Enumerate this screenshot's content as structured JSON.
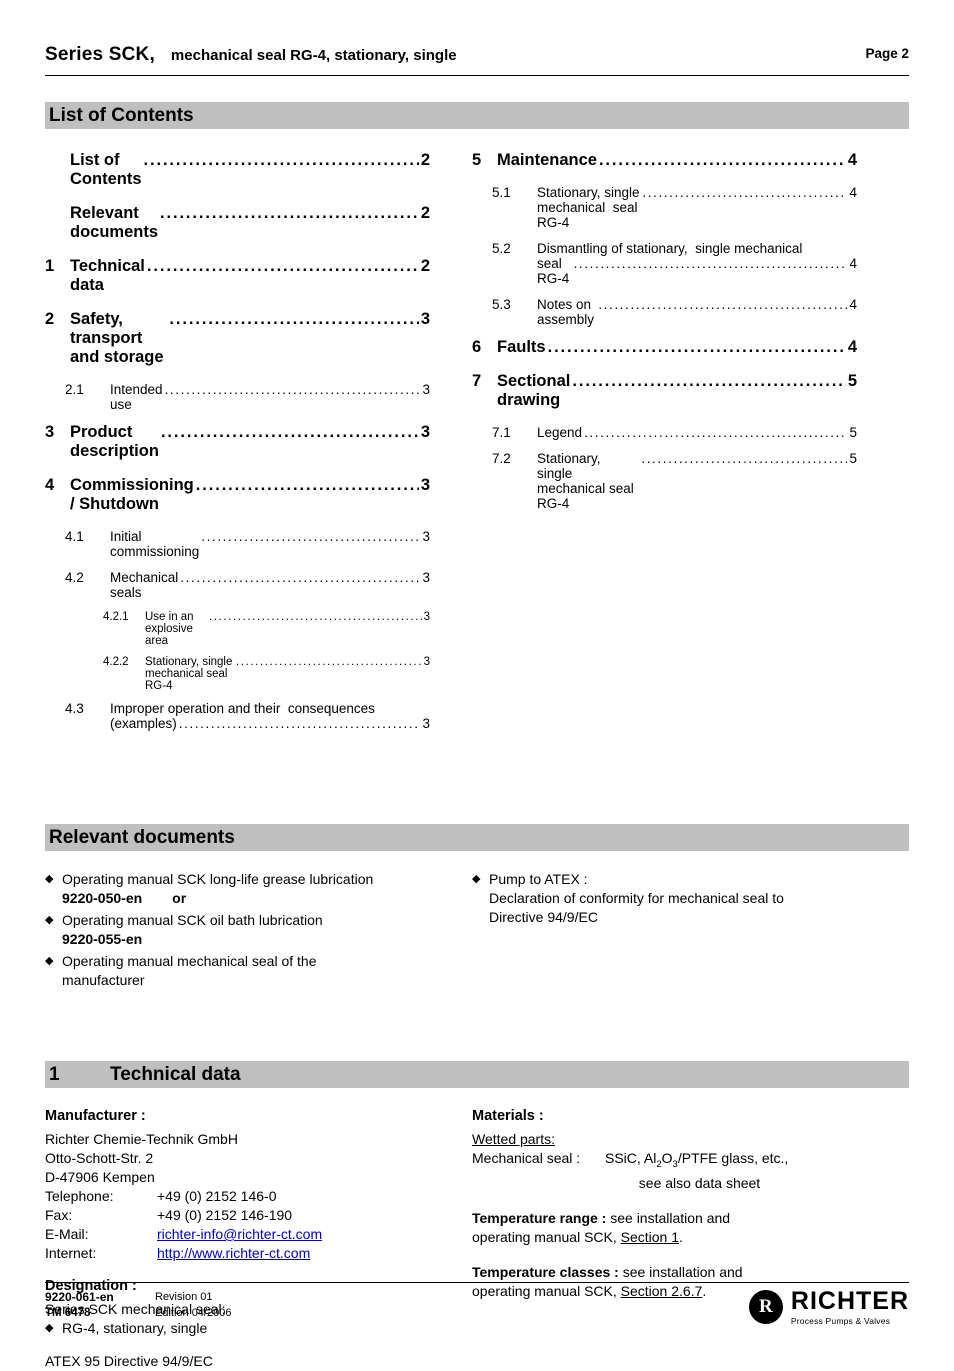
{
  "header": {
    "series": "Series SCK,",
    "subtitle": "mechanical seal RG-4, stationary, single",
    "page": "Page 2"
  },
  "toc": {
    "bar_title": "List of Contents",
    "left": [
      {
        "level": 1,
        "num": "",
        "text": "List of Contents",
        "page": "2"
      },
      {
        "level": 1,
        "num": "",
        "text": "Relevant documents",
        "page": "2"
      },
      {
        "level": 1,
        "num": "1",
        "text": "Technical data",
        "page": "2"
      },
      {
        "level": 1,
        "num": "2",
        "text": "Safety, transport and storage",
        "page": "3"
      },
      {
        "level": 2,
        "num": "2.1",
        "text": "Intended use",
        "page": "3"
      },
      {
        "level": 1,
        "num": "3",
        "text": "Product description",
        "page": "3"
      },
      {
        "level": 1,
        "num": "4",
        "text": "Commissioning / Shutdown",
        "page": "3"
      },
      {
        "level": 2,
        "num": "4.1",
        "text": "Initial commissioning",
        "page": "3"
      },
      {
        "level": 2,
        "num": "4.2",
        "text": "Mechanical seals",
        "page": "3"
      },
      {
        "level": 3,
        "num": "4.2.1",
        "text": "Use in an explosive area",
        "page": "3"
      },
      {
        "level": 3,
        "num": "4.2.2",
        "text": "Stationary, single mechanical seal  RG-4",
        "page": "3"
      },
      {
        "level": 2,
        "num": "4.3",
        "text": "Improper operation and their  consequences",
        "text2": "(examples)",
        "page": "3"
      }
    ],
    "right": [
      {
        "level": 1,
        "num": "5",
        "text": "Maintenance",
        "page": "4"
      },
      {
        "level": 2,
        "num": "5.1",
        "text": "Stationary, single mechanical  seal RG-4",
        "page": "4"
      },
      {
        "level": 2,
        "num": "5.2",
        "text": "Dismantling of stationary,  single mechanical",
        "text2": "seal RG-4",
        "page": "4"
      },
      {
        "level": 2,
        "num": "5.3",
        "text": "Notes on assembly",
        "page": "4"
      },
      {
        "level": 1,
        "num": "6",
        "text": "Faults",
        "page": "4"
      },
      {
        "level": 1,
        "num": "7",
        "text": "Sectional drawing",
        "page": "5"
      },
      {
        "level": 2,
        "num": "7.1",
        "text": "Legend",
        "page": "5"
      },
      {
        "level": 2,
        "num": "7.2",
        "text": "Stationary, single mechanical seal RG-4",
        "page": "5"
      }
    ]
  },
  "relevant_documents": {
    "bar_title": "Relevant documents",
    "left": [
      {
        "line1": "Operating manual SCK long-life grease lubrication",
        "bold": "9220-050-en",
        "after_bold": "or"
      },
      {
        "line1": "Operating manual SCK oil bath lubrication",
        "bold": "9220-055-en"
      },
      {
        "line1": "Operating  manual  mechanical  seal  of  the",
        "line2": "manufacturer"
      }
    ],
    "right": [
      {
        "line1": "Pump to ATEX :",
        "line2": "Declaration  of  conformity  for  mechanical  seal  to",
        "line3": "Directive 94/9/EC"
      }
    ]
  },
  "technical_data": {
    "bar_num": "1",
    "bar_title": "Technical data",
    "manufacturer_heading": "Manufacturer :",
    "manufacturer_lines": [
      "Richter Chemie-Technik GmbH",
      "Otto-Schott-Str. 2",
      "D-47906 Kempen"
    ],
    "contacts": [
      {
        "key": "Telephone:",
        "value": "+49 (0) 2152 146-0",
        "link": false
      },
      {
        "key": "Fax:",
        "value": "+49 (0) 2152 146-190",
        "link": false
      },
      {
        "key": "E-Mail:",
        "value": "richter-info@richter-ct.com",
        "link": true
      },
      {
        "key": "Internet:",
        "value": "http://www.richter-ct.com",
        "link": true
      }
    ],
    "designation_heading": "Designation :",
    "designation_line": "Series SCK  mechanical seal:",
    "designation_bullet": "RG-4, stationary, single",
    "atex_line": "ATEX 95  Directive 94/9/EC",
    "materials_heading": "Materials :",
    "wetted_parts": "Wetted parts:",
    "mech_seal_key": "Mechanical seal :",
    "mech_seal_value_pre": "SSiC, Al",
    "mech_seal_sub1": "2",
    "mech_seal_value_mid": "O",
    "mech_seal_sub2": "3",
    "mech_seal_value_post": "/PTFE glass, etc.,",
    "mech_seal_value_line2": "see also data sheet",
    "temperature_range_label": "Temperature range :",
    "temperature_range_text": "see installation and",
    "temperature_range_text2": "operating manual SCK, ",
    "temperature_range_link": "Section 1",
    "temperature_range_end": ".",
    "temperature_classes_label": "Temperature classes :",
    "temperature_classes_text": "see installation and",
    "temperature_classes_text2": "operating manual SCK, ",
    "temperature_classes_link": "Section 2.6.7",
    "temperature_classes_end": "."
  },
  "footer": {
    "doc_no": "9220-061-en",
    "revision": "Revision 01",
    "tm": "TM 6478",
    "edition": "Edition 04/2006",
    "logo_letter": "R",
    "logo_name": "RICHTER",
    "logo_tagline": "Process Pumps & Valves"
  }
}
